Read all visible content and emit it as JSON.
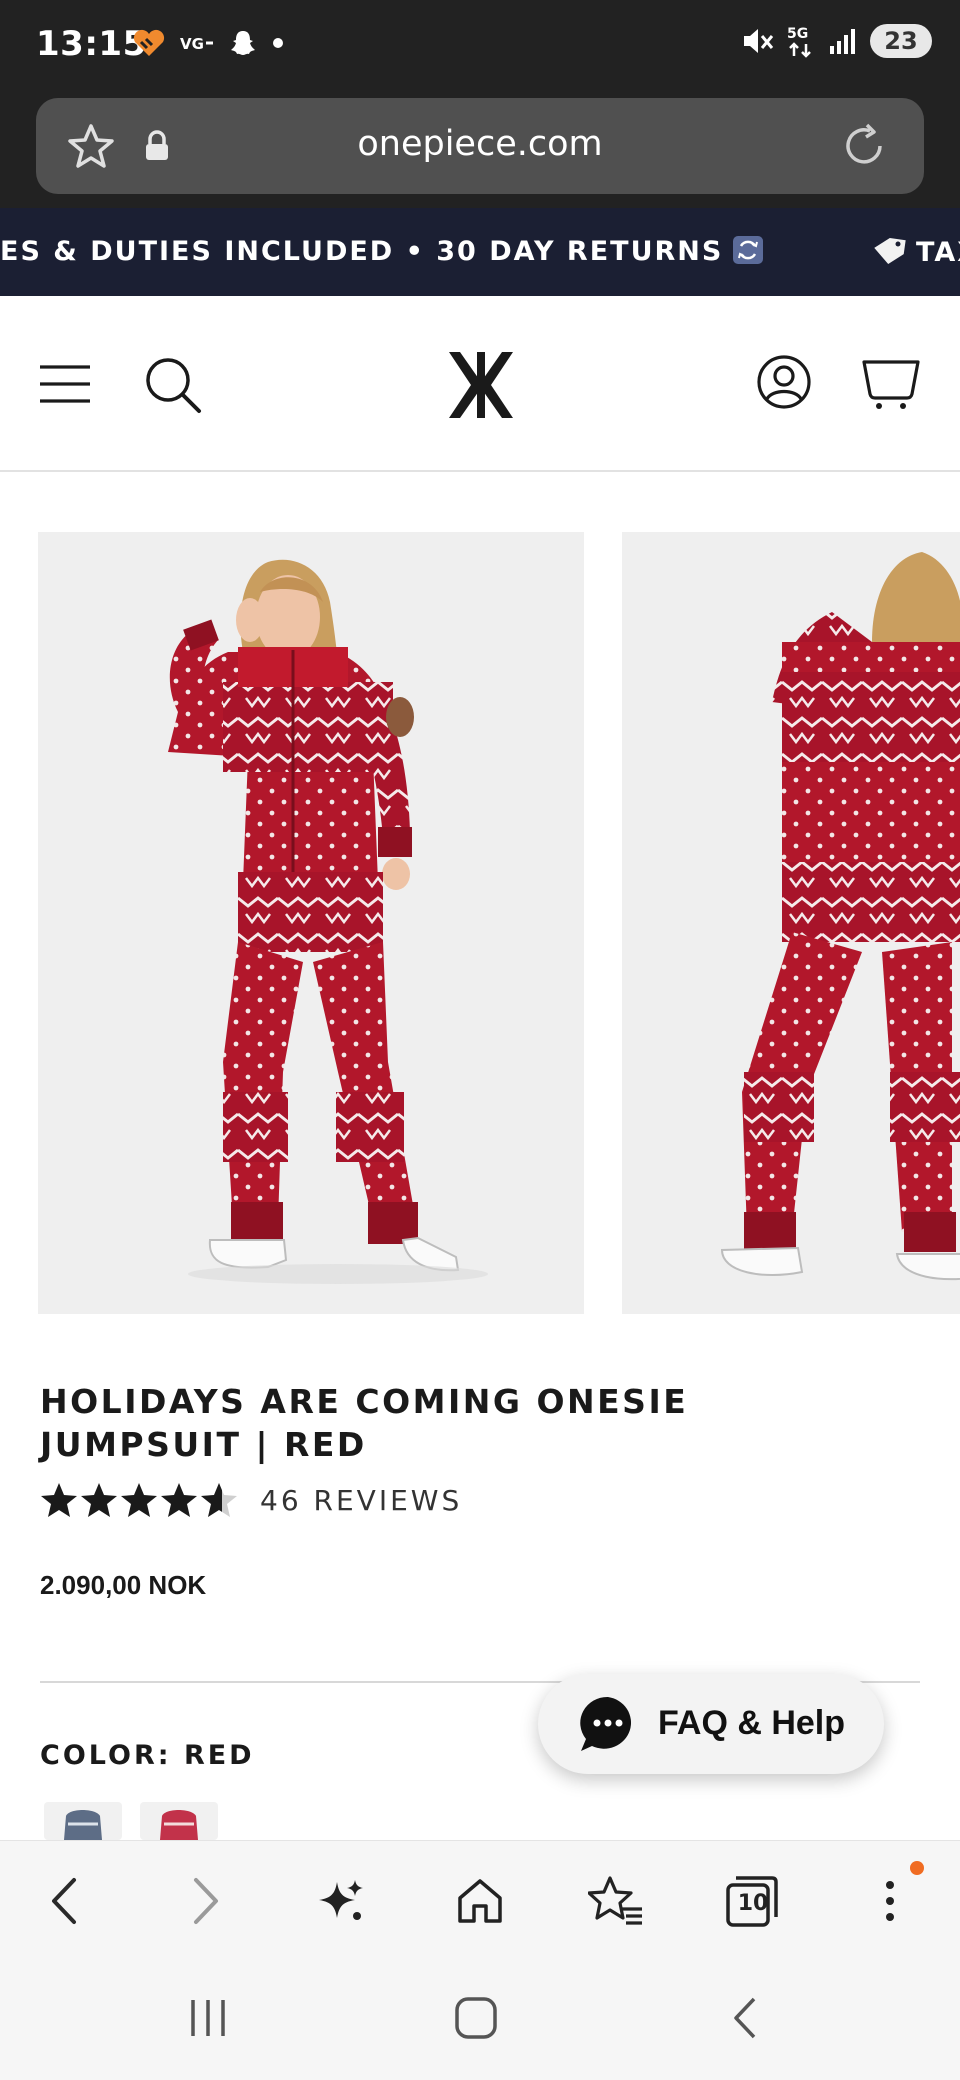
{
  "status_bar": {
    "time": "13:15",
    "battery": "23",
    "icons": [
      "heart-icon",
      "vg-icon",
      "snapchat-icon",
      "dot-icon",
      "mute-icon",
      "5g-icon",
      "signal-icon",
      "battery-icon"
    ]
  },
  "browser": {
    "url": "onepiece.com",
    "icons": [
      "star-icon",
      "lock-icon",
      "reload-icon"
    ]
  },
  "announcement": {
    "text": "ES & DUTIES INCLUDED • 30 DAY RETURNS",
    "text_next": "TAX"
  },
  "header": {
    "icons": [
      "menu-icon",
      "search-icon",
      "logo-icon",
      "account-icon",
      "cart-icon"
    ]
  },
  "product": {
    "title": "HOLIDAYS ARE COMING ONESIE JUMPSUIT | RED",
    "rating": 4.5,
    "reviews": "46 REVIEWS",
    "price": "2.090,00 NOK",
    "color_label": "COLOR: RED",
    "swatches": [
      "blue",
      "red"
    ]
  },
  "faq": {
    "label": "FAQ & Help"
  },
  "toolbar": {
    "tabs_count": "10",
    "icons": [
      "back-icon",
      "forward-icon",
      "sparkle-icon",
      "home-icon",
      "bookmarks-icon",
      "tabs-icon",
      "more-icon"
    ]
  },
  "colors": {
    "announce_bg": "#1b1f33",
    "status_bg": "#222222",
    "accent_dot": "#f06c22",
    "product_red": "#b2172b"
  }
}
